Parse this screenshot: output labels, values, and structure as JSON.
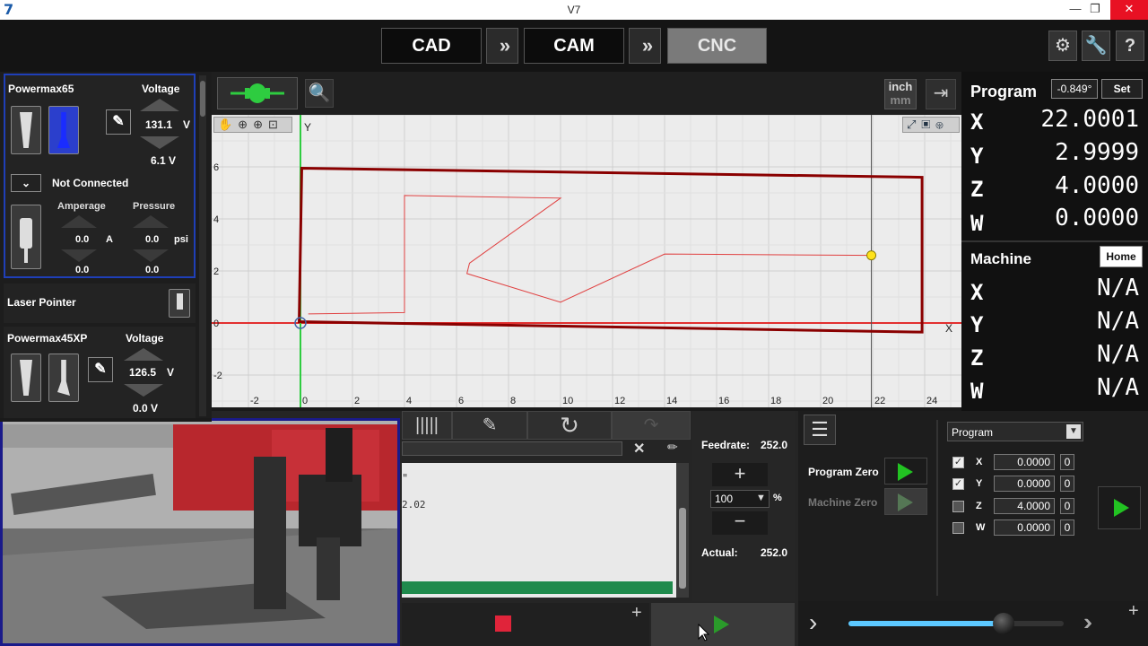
{
  "window": {
    "title": "V7",
    "logo": "7",
    "min": "—",
    "restore": "❐",
    "close": "✕"
  },
  "modes": {
    "cad": "CAD",
    "cam": "CAM",
    "cnc": "CNC",
    "sep": "»"
  },
  "tools": {
    "torch1": {
      "name": "Powermax65",
      "voltage_label": "Voltage",
      "voltage": "131.1",
      "voltage_unit": "V",
      "voltage_sub": "6.1 V",
      "connection": "Not Connected",
      "amperage_label": "Amperage",
      "amperage": "0.0",
      "amperage_unit": "A",
      "amperage_sub": "0.0",
      "pressure_label": "Pressure",
      "pressure": "0.0",
      "pressure_unit": "psi",
      "pressure_sub": "0.0"
    },
    "laser": {
      "name": "Laser Pointer"
    },
    "torch2": {
      "name": "Powermax45XP",
      "voltage_label": "Voltage",
      "voltage": "126.5",
      "voltage_unit": "V",
      "voltage_sub": "0.0 V"
    }
  },
  "canvas": {
    "units": {
      "top": "inch",
      "bottom": "mm"
    },
    "x_axis_label": "X",
    "y_axis_label": "Y",
    "x_ticks": [
      "-2",
      "0",
      "2",
      "4",
      "6",
      "8",
      "10",
      "12",
      "14",
      "16",
      "18",
      "20",
      "22",
      "24"
    ],
    "y_ticks": [
      "6",
      "4",
      "2",
      "0",
      "-2"
    ]
  },
  "program": {
    "title": "Program",
    "angle": "-0.849°",
    "set_label": "Set",
    "axes": [
      {
        "axis": "X",
        "value": "22.0001"
      },
      {
        "axis": "Y",
        "value": "2.9999"
      },
      {
        "axis": "Z",
        "value": "4.0000"
      },
      {
        "axis": "W",
        "value": "0.0000"
      }
    ]
  },
  "machine": {
    "title": "Machine",
    "home_label": "Home",
    "axes": [
      {
        "axis": "X",
        "value": "N/A"
      },
      {
        "axis": "Y",
        "value": "N/A"
      },
      {
        "axis": "Z",
        "value": "N/A"
      },
      {
        "axis": "W",
        "value": "N/A"
      }
    ]
  },
  "gcode": {
    "line1": "\"",
    "line2": "2.02"
  },
  "feed": {
    "feedrate_label": "Feedrate:",
    "feedrate": "252.0",
    "override": "100",
    "percent": "%",
    "actual_label": "Actual:",
    "actual": "252.0"
  },
  "zeroing": {
    "program_zero": "Program Zero",
    "machine_zero": "Machine Zero",
    "select_value": "Program",
    "rows": [
      {
        "axis": "X",
        "checked": "✓",
        "value": "0.0000",
        "extra": "0"
      },
      {
        "axis": "Y",
        "checked": "✓",
        "value": "0.0000",
        "extra": "0"
      },
      {
        "axis": "Z",
        "checked": "",
        "value": "4.0000",
        "extra": "0"
      },
      {
        "axis": "W",
        "checked": "",
        "value": "0.0000",
        "extra": "0"
      }
    ]
  },
  "jog": {
    "speed_fraction": 0.72
  },
  "colors": {
    "accent_blue": "#1f3fb8",
    "go_green": "#22c322",
    "part_red": "#8a0000",
    "stop_red": "#e0243a"
  }
}
